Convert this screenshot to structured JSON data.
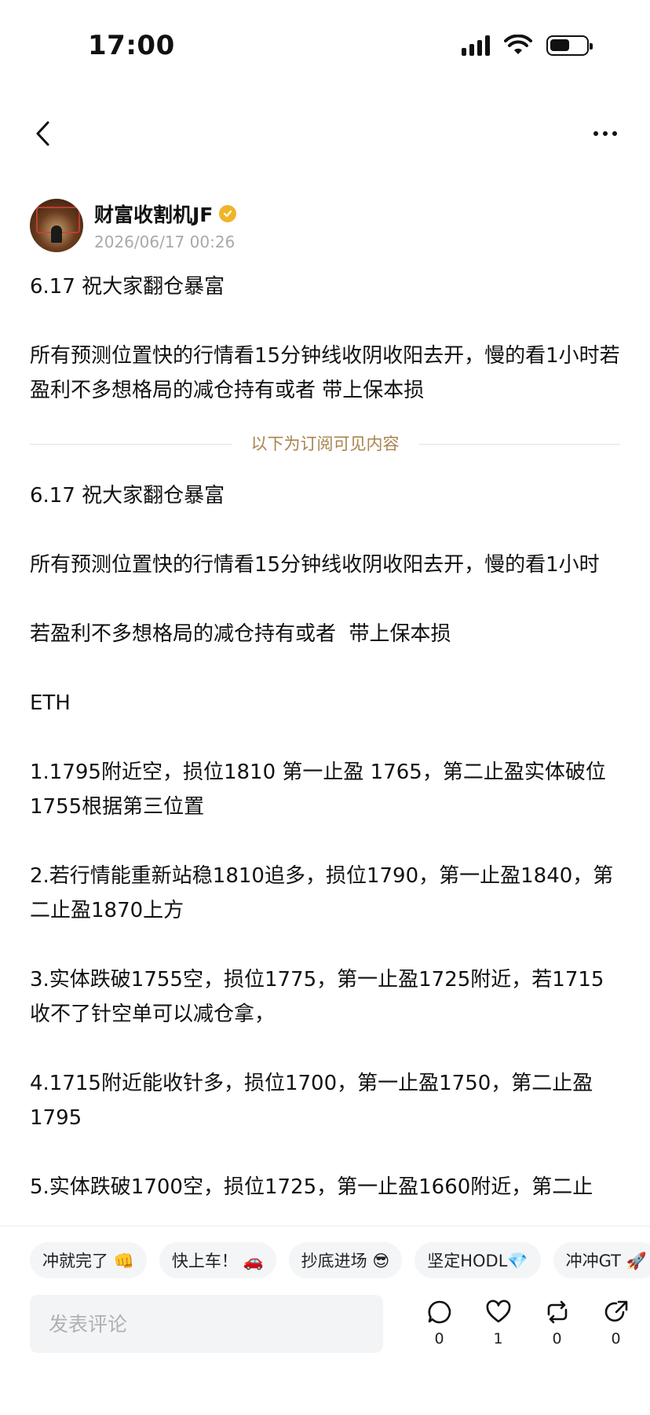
{
  "status_bar": {
    "time": "17:00",
    "battery_level": 0.55
  },
  "nav": {
    "back_icon": "chevron-left-icon",
    "more_icon": "more-icon"
  },
  "author": {
    "name": "财富收割机JF",
    "date": "2026/06/17 00:26",
    "verified_color": "#f0b429"
  },
  "post": {
    "intro": [
      "6.17 祝大家翻仓暴富",
      "所有预测位置快的行情看15分钟线收阴收阳去开，慢的看1小时若盈利不多想格局的减仓持有或者 带上保本损"
    ],
    "divider_text": "以下为订阅可见内容",
    "body": [
      "6.17 祝大家翻仓暴富",
      "所有预测位置快的行情看15分钟线收阴收阳去开，慢的看1小时",
      "若盈利不多想格局的减仓持有或者  带上保本损",
      "ETH",
      "1.1795附近空，损位1810 第一止盈 1765，第二止盈实体破位1755根据第三位置",
      "2.若行情能重新站稳1810追多，损位1790，第一止盈1840，第二止盈1870上方",
      "3.实体跌破1755空，损位1775，第一止盈1725附近，若1715收不了针空单可以减仓拿，",
      "4.1715附近能收针多，损位1700，第一止盈1750，第二止盈1795",
      "5.实体跌破1700空，损位1725，第一止盈1660附近，第二止"
    ]
  },
  "quick_replies": [
    "冲就完了 👊",
    "快上车！ 🚗",
    "抄底进场 😎",
    "坚定HODL💎",
    "冲冲GT 🚀"
  ],
  "comment": {
    "placeholder": "发表评论"
  },
  "actions": [
    {
      "icon": "comment-icon",
      "count": "0"
    },
    {
      "icon": "heart-icon",
      "count": "1"
    },
    {
      "icon": "repost-icon",
      "count": "0"
    },
    {
      "icon": "share-icon",
      "count": "0"
    }
  ]
}
